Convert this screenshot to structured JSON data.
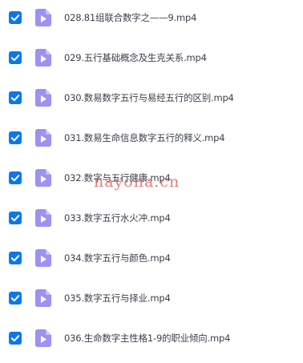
{
  "colors": {
    "checkbox": "#0d77ea",
    "file_icon": "#9b92f2",
    "file_icon_fold": "#c9c3f8",
    "text": "#3a3f4a",
    "watermark": "#d9534f"
  },
  "files": [
    {
      "name": "028.81组联合数字之——9.mp4",
      "checked": true,
      "icon": "video-file-icon"
    },
    {
      "name": "029.五行基础概念及生克关系.mp4",
      "checked": true,
      "icon": "video-file-icon"
    },
    {
      "name": "030.数易数字五行与易经五行的区别.mp4",
      "checked": true,
      "icon": "video-file-icon"
    },
    {
      "name": "031.数易生命信息数字五行的释义.mp4",
      "checked": true,
      "icon": "video-file-icon"
    },
    {
      "name": "032.数字与五行健康.mp4",
      "checked": true,
      "icon": "video-file-icon"
    },
    {
      "name": "033.数字五行水火冲.mp4",
      "checked": true,
      "icon": "video-file-icon"
    },
    {
      "name": "034.数字五行与颜色.mp4",
      "checked": true,
      "icon": "video-file-icon"
    },
    {
      "name": "035.数字五行与择业.mp4",
      "checked": true,
      "icon": "video-file-icon"
    },
    {
      "name": "036.生命数字主性格1-9的职业倾向.mp4",
      "checked": true,
      "icon": "video-file-icon"
    }
  ],
  "watermark": "nayona.cn"
}
